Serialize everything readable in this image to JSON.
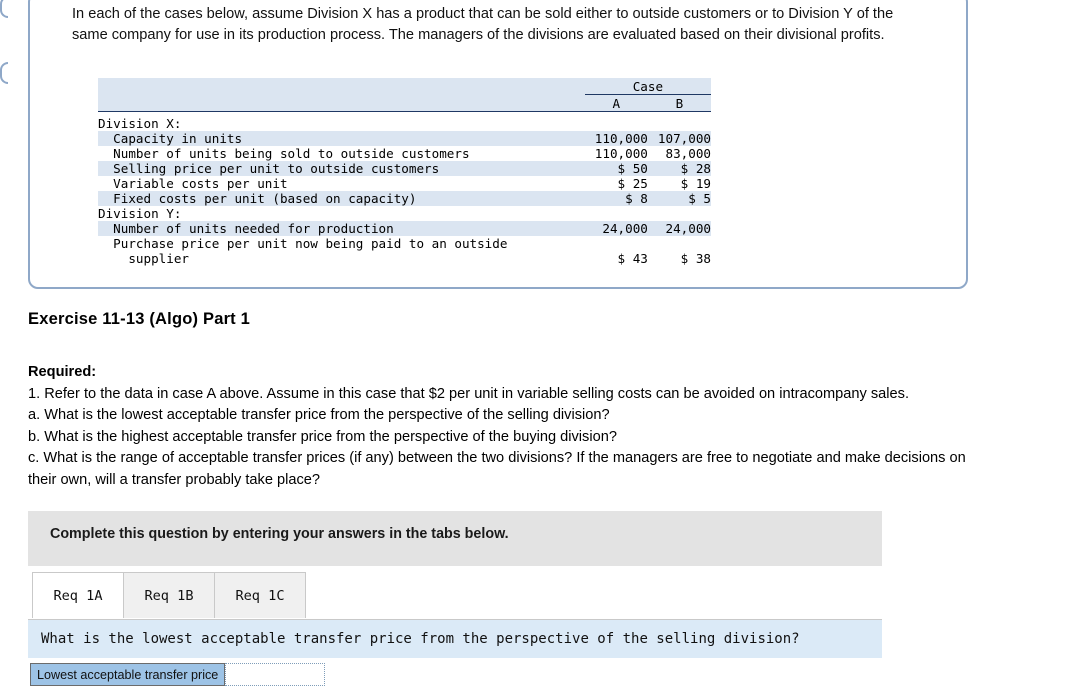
{
  "intro": {
    "paragraph": "In each of the cases below, assume Division X has a product that can be sold either to outside customers or to Division Y of the same company for use in its production process. The managers of the divisions are evaluated based on their divisional profits."
  },
  "table": {
    "case_header": "Case",
    "columns": [
      "A",
      "B"
    ],
    "rows": [
      {
        "label": "Division X:",
        "a": "",
        "b": "",
        "shaded": false
      },
      {
        "label": "  Capacity in units",
        "a": "110,000",
        "b": "107,000",
        "shaded": true
      },
      {
        "label": "  Number of units being sold to outside customers",
        "a": "110,000",
        "b": "83,000",
        "shaded": false
      },
      {
        "label": "  Selling price per unit to outside customers",
        "a": "$ 50",
        "b": "$ 28",
        "shaded": true
      },
      {
        "label": "  Variable costs per unit",
        "a": "$ 25",
        "b": "$ 19",
        "shaded": false
      },
      {
        "label": "  Fixed costs per unit (based on capacity)",
        "a": "$ 8",
        "b": "$ 5",
        "shaded": true
      },
      {
        "label": "Division Y:",
        "a": "",
        "b": "",
        "shaded": false
      },
      {
        "label": "  Number of units needed for production",
        "a": "24,000",
        "b": "24,000",
        "shaded": true
      },
      {
        "label": "  Purchase price per unit now being paid to an outside",
        "a": "",
        "b": "",
        "shaded": false
      },
      {
        "label": "    supplier",
        "a": "$ 43",
        "b": "$ 38",
        "shaded": false
      }
    ]
  },
  "exercise_title": "Exercise 11-13 (Algo) Part 1",
  "required": {
    "heading": "Required:",
    "line1": "1. Refer to the data in case A above. Assume in this case that $2 per unit in variable selling costs can be avoided on intracompany sales.",
    "line_a": "a. What is the lowest acceptable transfer price from the perspective of the selling division?",
    "line_b": "b. What is the highest acceptable transfer price from the perspective of the buying division?",
    "line_c": "c. What is the range of acceptable transfer prices (if any) between the two divisions? If the managers are free to negotiate and make decisions on their own, will a transfer probably take place?"
  },
  "instruction_bar": {
    "text": "Complete this question by entering your answers in the tabs below."
  },
  "tabs": [
    {
      "label": "Req 1A",
      "active": true
    },
    {
      "label": "Req 1B",
      "active": false
    },
    {
      "label": "Req 1C",
      "active": false
    }
  ],
  "question_bar": {
    "text": "What is the lowest acceptable transfer price from the perspective of the selling division?"
  },
  "answer": {
    "label": "Lowest acceptable transfer price",
    "value": "",
    "placeholder": ""
  },
  "colors": {
    "card_border": "#8fa8c8",
    "table_shade": "#dbe5f1",
    "instruction_bg": "#e3e3e3",
    "question_bg": "#dbeaf7",
    "answer_label_bg": "#9dc3e6"
  }
}
